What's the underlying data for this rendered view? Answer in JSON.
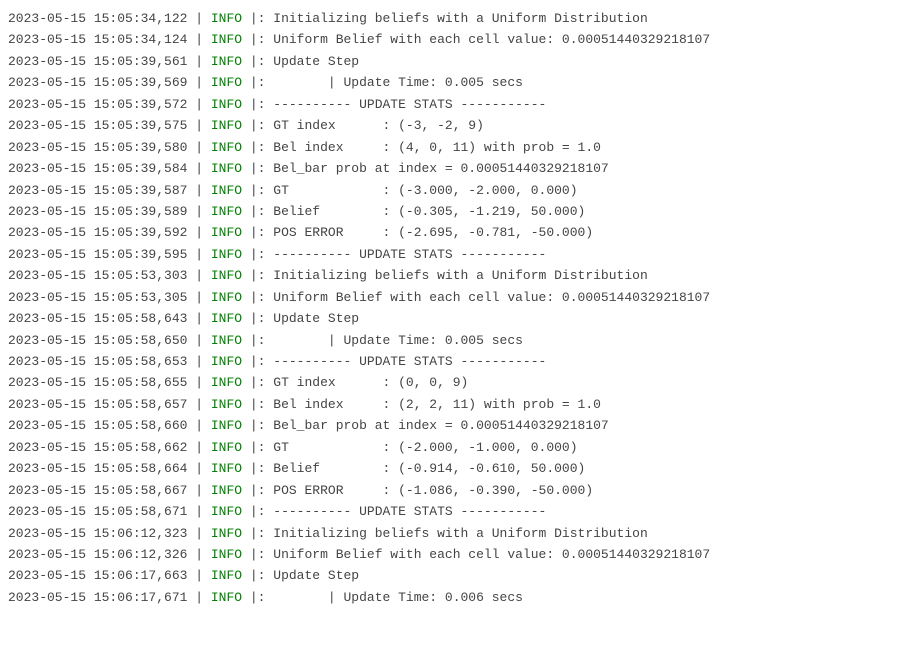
{
  "colors": {
    "info": "#008000",
    "text": "#444444"
  },
  "lines": [
    {
      "ts": "2023-05-15 15:05:34,122",
      "level": "INFO",
      "msg": "|: Initializing beliefs with a Uniform Distribution"
    },
    {
      "ts": "2023-05-15 15:05:34,124",
      "level": "INFO",
      "msg": "|: Uniform Belief with each cell value: 0.00051440329218107"
    },
    {
      "ts": "2023-05-15 15:05:39,561",
      "level": "INFO",
      "msg": "|: Update Step"
    },
    {
      "ts": "2023-05-15 15:05:39,569",
      "level": "INFO",
      "msg": "|:        | Update Time: 0.005 secs"
    },
    {
      "ts": "2023-05-15 15:05:39,572",
      "level": "INFO",
      "msg": "|: ---------- UPDATE STATS -----------"
    },
    {
      "ts": "2023-05-15 15:05:39,575",
      "level": "INFO",
      "msg": "|: GT index      : (-3, -2, 9)"
    },
    {
      "ts": "2023-05-15 15:05:39,580",
      "level": "INFO",
      "msg": "|: Bel index     : (4, 0, 11) with prob = 1.0"
    },
    {
      "ts": "2023-05-15 15:05:39,584",
      "level": "INFO",
      "msg": "|: Bel_bar prob at index = 0.00051440329218107"
    },
    {
      "ts": "2023-05-15 15:05:39,587",
      "level": "INFO",
      "msg": "|: GT            : (-3.000, -2.000, 0.000)"
    },
    {
      "ts": "2023-05-15 15:05:39,589",
      "level": "INFO",
      "msg": "|: Belief        : (-0.305, -1.219, 50.000)"
    },
    {
      "ts": "2023-05-15 15:05:39,592",
      "level": "INFO",
      "msg": "|: POS ERROR     : (-2.695, -0.781, -50.000)"
    },
    {
      "ts": "2023-05-15 15:05:39,595",
      "level": "INFO",
      "msg": "|: ---------- UPDATE STATS -----------"
    },
    {
      "ts": "2023-05-15 15:05:53,303",
      "level": "INFO",
      "msg": "|: Initializing beliefs with a Uniform Distribution"
    },
    {
      "ts": "2023-05-15 15:05:53,305",
      "level": "INFO",
      "msg": "|: Uniform Belief with each cell value: 0.00051440329218107"
    },
    {
      "ts": "2023-05-15 15:05:58,643",
      "level": "INFO",
      "msg": "|: Update Step"
    },
    {
      "ts": "2023-05-15 15:05:58,650",
      "level": "INFO",
      "msg": "|:        | Update Time: 0.005 secs"
    },
    {
      "ts": "2023-05-15 15:05:58,653",
      "level": "INFO",
      "msg": "|: ---------- UPDATE STATS -----------"
    },
    {
      "ts": "2023-05-15 15:05:58,655",
      "level": "INFO",
      "msg": "|: GT index      : (0, 0, 9)"
    },
    {
      "ts": "2023-05-15 15:05:58,657",
      "level": "INFO",
      "msg": "|: Bel index     : (2, 2, 11) with prob = 1.0"
    },
    {
      "ts": "2023-05-15 15:05:58,660",
      "level": "INFO",
      "msg": "|: Bel_bar prob at index = 0.00051440329218107"
    },
    {
      "ts": "2023-05-15 15:05:58,662",
      "level": "INFO",
      "msg": "|: GT            : (-2.000, -1.000, 0.000)"
    },
    {
      "ts": "2023-05-15 15:05:58,664",
      "level": "INFO",
      "msg": "|: Belief        : (-0.914, -0.610, 50.000)"
    },
    {
      "ts": "2023-05-15 15:05:58,667",
      "level": "INFO",
      "msg": "|: POS ERROR     : (-1.086, -0.390, -50.000)"
    },
    {
      "ts": "2023-05-15 15:05:58,671",
      "level": "INFO",
      "msg": "|: ---------- UPDATE STATS -----------"
    },
    {
      "ts": "2023-05-15 15:06:12,323",
      "level": "INFO",
      "msg": "|: Initializing beliefs with a Uniform Distribution"
    },
    {
      "ts": "2023-05-15 15:06:12,326",
      "level": "INFO",
      "msg": "|: Uniform Belief with each cell value: 0.00051440329218107"
    },
    {
      "ts": "2023-05-15 15:06:17,663",
      "level": "INFO",
      "msg": "|: Update Step"
    },
    {
      "ts": "2023-05-15 15:06:17,671",
      "level": "INFO",
      "msg": "|:        | Update Time: 0.006 secs"
    }
  ]
}
